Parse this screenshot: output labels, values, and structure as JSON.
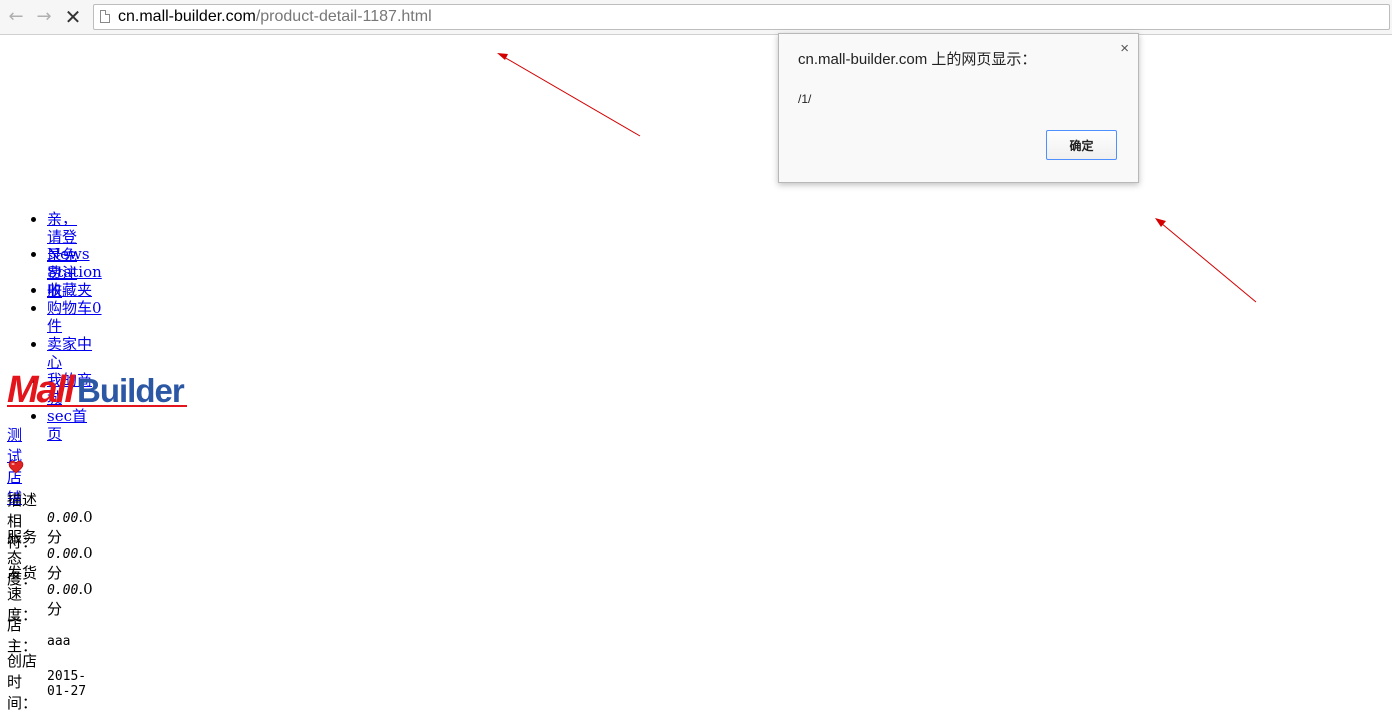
{
  "browser": {
    "url_host": "cn.mall-builder.com",
    "url_path": "/product-detail-1187.html"
  },
  "header": {
    "login_link": "亲，请登录免费注册",
    "nav": [
      "News Station",
      "收藏夹",
      "购物车0件",
      "卖家中心",
      "我的商城",
      "sec首页"
    ]
  },
  "shop": {
    "logo_text_mall": "Mall",
    "logo_text_builder": "Builder",
    "name": "测试店铺",
    "ratings": [
      {
        "label": "描述相符：",
        "value_italic": "0.00",
        "value_suffix": ".0分"
      },
      {
        "label": "服务态度：",
        "value_italic": "0.00",
        "value_suffix": ".0分"
      },
      {
        "label": "发货速度：",
        "value_italic": "0.00",
        "value_suffix": ".0分"
      }
    ],
    "owner_label": "店主：",
    "owner": "aaa",
    "created_label": "创店时间：",
    "created": "2015-01-27"
  },
  "dialog": {
    "title": "cn.mall-builder.com 上的网页显示：",
    "message": "/1/",
    "ok_label": "确定",
    "close_label": "×"
  },
  "colors": {
    "arrow": "#d40000",
    "link": "#0000ee",
    "dialog_button_border": "#4d90fe"
  }
}
